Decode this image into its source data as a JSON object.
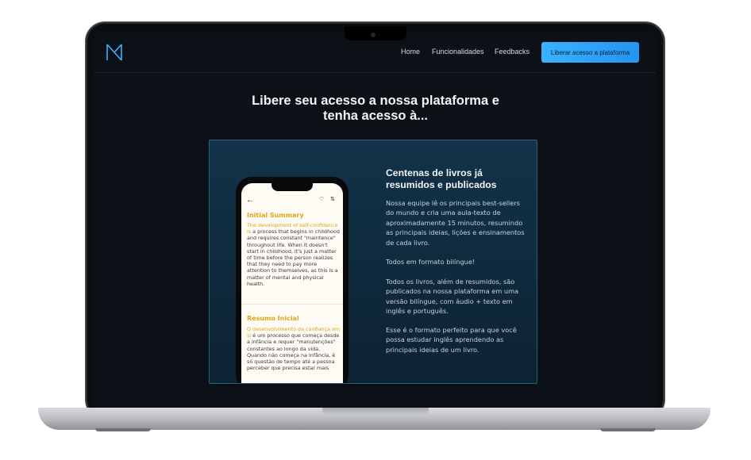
{
  "nav": {
    "links": [
      "Home",
      "Funcionalidades",
      "Feedbacks"
    ],
    "cta_label": "Liberar acesso a plataforma"
  },
  "hero": {
    "title": "Libere seu acesso a nossa plataforma e tenha acesso à..."
  },
  "feature": {
    "title": "Centenas de livros já resumidos e publicados",
    "paragraphs": [
      "Nossa equipe lê os principais best-sellers do mundo e cria uma aula-texto de aproximadamente 15 minutos, resumindo as principais ideias, lições e ensinamentos de cada livro.",
      "Todos em formato bilíngue!",
      "Todos os livros, além de resumidos, são publicados na nossa plataforma em uma versão bilíngue, com áudio + texto em inglês e português.",
      "Esse é o formato perfeito para que você possa estudar inglês aprendendo as principais ideias de um livro."
    ]
  },
  "phone": {
    "section1": {
      "title": "Initial Summary",
      "highlight": "The development of self-confidence is",
      "text": " a process that begins in childhood and requires constant \"maintence\" throughout life. When it doesn't start in childhood, it's just a matter of time before the person realizes that they need to pay more attention to themselves, as this is a matter of mental and physical health."
    },
    "section2": {
      "title": "Resumo Inicial",
      "highlight": "O desenvolvimento da confiança em si",
      "text": " é um processo que começa desde a infância e requer \"manutenções\" constantes ao longo da vida. Quando não começa na infância, é só questão de tempo até a pessoa perceber que precisa estar mais"
    }
  },
  "colors": {
    "accent": "#2ea6ff",
    "highlight": "#e0a417",
    "background": "#0c1117"
  }
}
